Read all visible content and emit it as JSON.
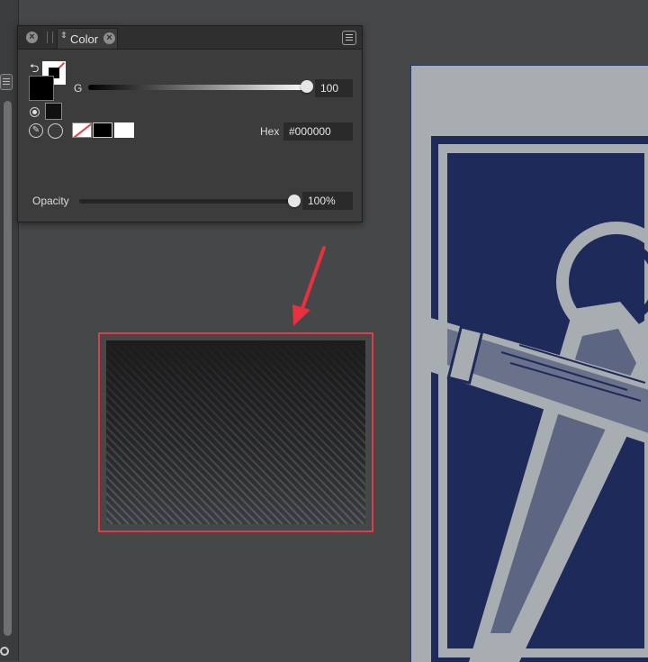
{
  "panel": {
    "tab_title": "Color",
    "close_glyph": "×",
    "tab_sort_glyph": "⇕",
    "g_label": "G",
    "g_value": "100",
    "g_level_percent": 100,
    "hex_label": "Hex",
    "hex_value": "#000000",
    "opacity_label": "Opacity",
    "opacity_value": "100%",
    "opacity_level_percent": 100,
    "fill_color": "#000000",
    "stroke_color": "#ffffff",
    "icons": {
      "close": "close-icon",
      "menu": "panel-menu-icon",
      "swap": "swap-colors-icon",
      "picker": "eyedropper-icon",
      "circle": "circle-icon"
    },
    "quick_swatches": [
      "none",
      "#000000",
      "#ffffff"
    ]
  },
  "colors": {
    "canvas_bg": "#464749",
    "panel_bg": "#3c3c3d",
    "highlight": "#e23b4a",
    "artboard_navy": "#1e2a5a",
    "artboard_gray": "#a8adb2"
  }
}
